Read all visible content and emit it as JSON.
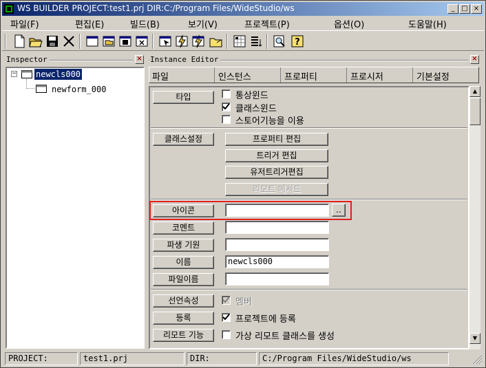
{
  "window": {
    "title": "WS BUILDER PROJECT:test1.prj DIR:C:/Program Files/WideStudio/ws",
    "controls": [
      "_",
      "□",
      "×"
    ]
  },
  "menu": [
    "파일(F)",
    "편집(E)",
    "빌드(B)",
    "보기(V)",
    "프로젝트(P)",
    "옵션(O)",
    "도움말(H)"
  ],
  "toolbar_icons": [
    "new-file-icon",
    "open-folder-icon",
    "save-icon",
    "cut-icon",
    "new-window-icon",
    "open-window-icon",
    "save-window-icon",
    "close-window-icon",
    "select-icon",
    "event-icon",
    "event-edit-icon",
    "folder-icon",
    "grid-icon",
    "list-icon",
    "search-doc-icon",
    "help-icon"
  ],
  "inspector": {
    "label": "Inspector",
    "close": "×",
    "tree": {
      "root": "newcls000",
      "child": "newform_000",
      "expander": "−"
    }
  },
  "instance_editor": {
    "label": "Instance Editor",
    "close": "×",
    "tabs": [
      "파일",
      "인스턴스",
      "프로퍼티",
      "프로시저",
      "기본설정"
    ]
  },
  "editor": {
    "type_button": "타입",
    "type_options": [
      {
        "label": "통상윈드",
        "checked": false
      },
      {
        "label": "클래스윈드",
        "checked": true
      },
      {
        "label": "스토어기능을 이용",
        "checked": false
      }
    ],
    "class_settings_button": "클래스설정",
    "property_edit": "프로퍼티 편집",
    "trigger_edit": "트리거 편집",
    "user_trigger_edit": "유저트리거편집",
    "remote_method": "리모트 메서드",
    "icon_button": "아이콘",
    "icon_value": "",
    "browse_button": "..",
    "comment_button": "코멘트",
    "comment_value": "",
    "derive_button": "파생 기원",
    "derive_value": "",
    "name_button": "이름",
    "name_value": "newcls000",
    "filename_button": "파일이름",
    "filename_value": "",
    "declare_button": "선언속성",
    "member_label": "멤버",
    "member_checked": true,
    "register_button": "등록",
    "register_label": "프로젝트에 등록",
    "register_checked": true,
    "remote_button": "리모트 기능",
    "remote_label": "가상 리모트 클래스를 생성",
    "remote_checked": false
  },
  "statusbar": {
    "project_label": "PROJECT:",
    "project_value": "test1.prj",
    "dir_label": "DIR:",
    "dir_value": "C:/Program Files/WideStudio/ws"
  },
  "colors": {
    "titlebar": "#0a246a",
    "highlight": "#e02020",
    "selection": "#0a246a"
  }
}
